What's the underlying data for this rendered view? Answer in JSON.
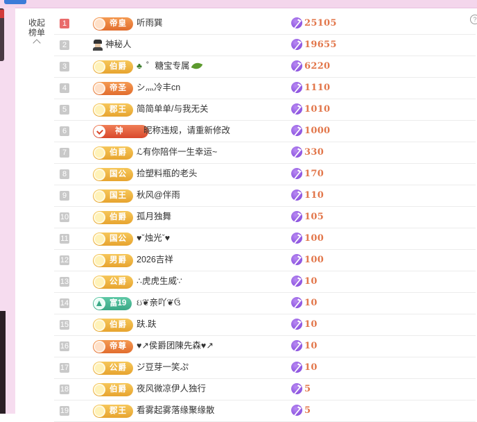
{
  "panel": {
    "collapse_label": "收起榜单",
    "help_label": "?"
  },
  "colors": {
    "rank_first": "#e96b6b",
    "rank_default": "#c9c9c9",
    "value_text": "#e2764a",
    "coin": "#7a3ed8"
  },
  "rows": [
    {
      "rank": "1",
      "badge": "帝皇",
      "badge_style": "orange",
      "name": "听雨巽",
      "value": "25105"
    },
    {
      "rank": "2",
      "badge": "",
      "badge_style": "mystery",
      "name": "神秘人",
      "value": "19655"
    },
    {
      "rank": "3",
      "badge": "伯爵",
      "badge_style": "gold",
      "name": "゜糖宝专属",
      "value": "6220"
    },
    {
      "rank": "4",
      "badge": "帝圣",
      "badge_style": "orange",
      "name": "シ灬冷丰cn",
      "value": "1110"
    },
    {
      "rank": "5",
      "badge": "郡王",
      "badge_style": "gold",
      "name": "简简单单/与我无关",
      "value": "1010"
    },
    {
      "rank": "6",
      "badge": "神",
      "badge_style": "red",
      "name": "昵称违规，请重新修改",
      "value": "1000"
    },
    {
      "rank": "7",
      "badge": "伯爵",
      "badge_style": "gold",
      "name": "ℒ有你陪伴一生幸运~",
      "value": "330"
    },
    {
      "rank": "8",
      "badge": "国公",
      "badge_style": "gold",
      "name": "捡塑料瓶的老头",
      "value": "170"
    },
    {
      "rank": "9",
      "badge": "国王",
      "badge_style": "gold",
      "name": "秋风@伴雨",
      "value": "110"
    },
    {
      "rank": "10",
      "badge": "伯爵",
      "badge_style": "gold",
      "name": "孤月独舞",
      "value": "105"
    },
    {
      "rank": "11",
      "badge": "国公",
      "badge_style": "gold",
      "name": "♥ˇ烛光ˇ♥",
      "value": "100"
    },
    {
      "rank": "12",
      "badge": "男爵",
      "badge_style": "gold",
      "name": "2026吉祥",
      "value": "100"
    },
    {
      "rank": "13",
      "badge": "公爵",
      "badge_style": "gold",
      "name": "∴虎虎生威∵",
      "value": "10"
    },
    {
      "rank": "14",
      "badge": "富19",
      "badge_style": "green",
      "name": "ઇ❦亲吖❦ઉ",
      "value": "10"
    },
    {
      "rank": "15",
      "badge": "伯爵",
      "badge_style": "gold",
      "name": "趺.趺",
      "value": "10"
    },
    {
      "rank": "16",
      "badge": "帝尊",
      "badge_style": "orange",
      "name": "♥↗侯爵团陳先森♥↗",
      "value": "10"
    },
    {
      "rank": "17",
      "badge": "公爵",
      "badge_style": "gold",
      "name": "ジ豆芽一笑ぷ",
      "value": "10"
    },
    {
      "rank": "18",
      "badge": "伯爵",
      "badge_style": "gold",
      "name": "夜风微凉伊人独行",
      "value": "5"
    },
    {
      "rank": "19",
      "badge": "郡王",
      "badge_style": "gold",
      "name": "看雾起雾落缘聚缘散",
      "value": "5"
    }
  ]
}
